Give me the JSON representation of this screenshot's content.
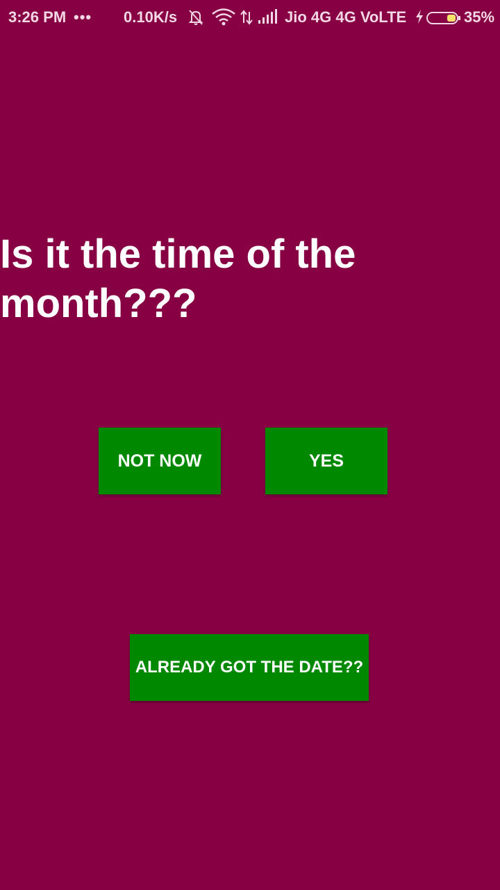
{
  "status_bar": {
    "time": "3:26 PM",
    "more": "•••",
    "net_speed": "0.10K/s",
    "carrier": "Jio 4G  4G  VoLTE",
    "battery_percent": "35%",
    "battery_level": 0.35,
    "icons": [
      "bell-off-icon",
      "wifi-icon",
      "data-arrows-icon",
      "signal-icon",
      "charging-bolt-icon",
      "battery-icon"
    ]
  },
  "question": {
    "text": "Is it the time of the month???"
  },
  "buttons": {
    "not_now": "NOT NOW",
    "yes": "YES",
    "already": "ALREADY GOT THE DATE??"
  },
  "colors": {
    "background": "#880044",
    "button": "#008800",
    "text": "#ffffff"
  }
}
